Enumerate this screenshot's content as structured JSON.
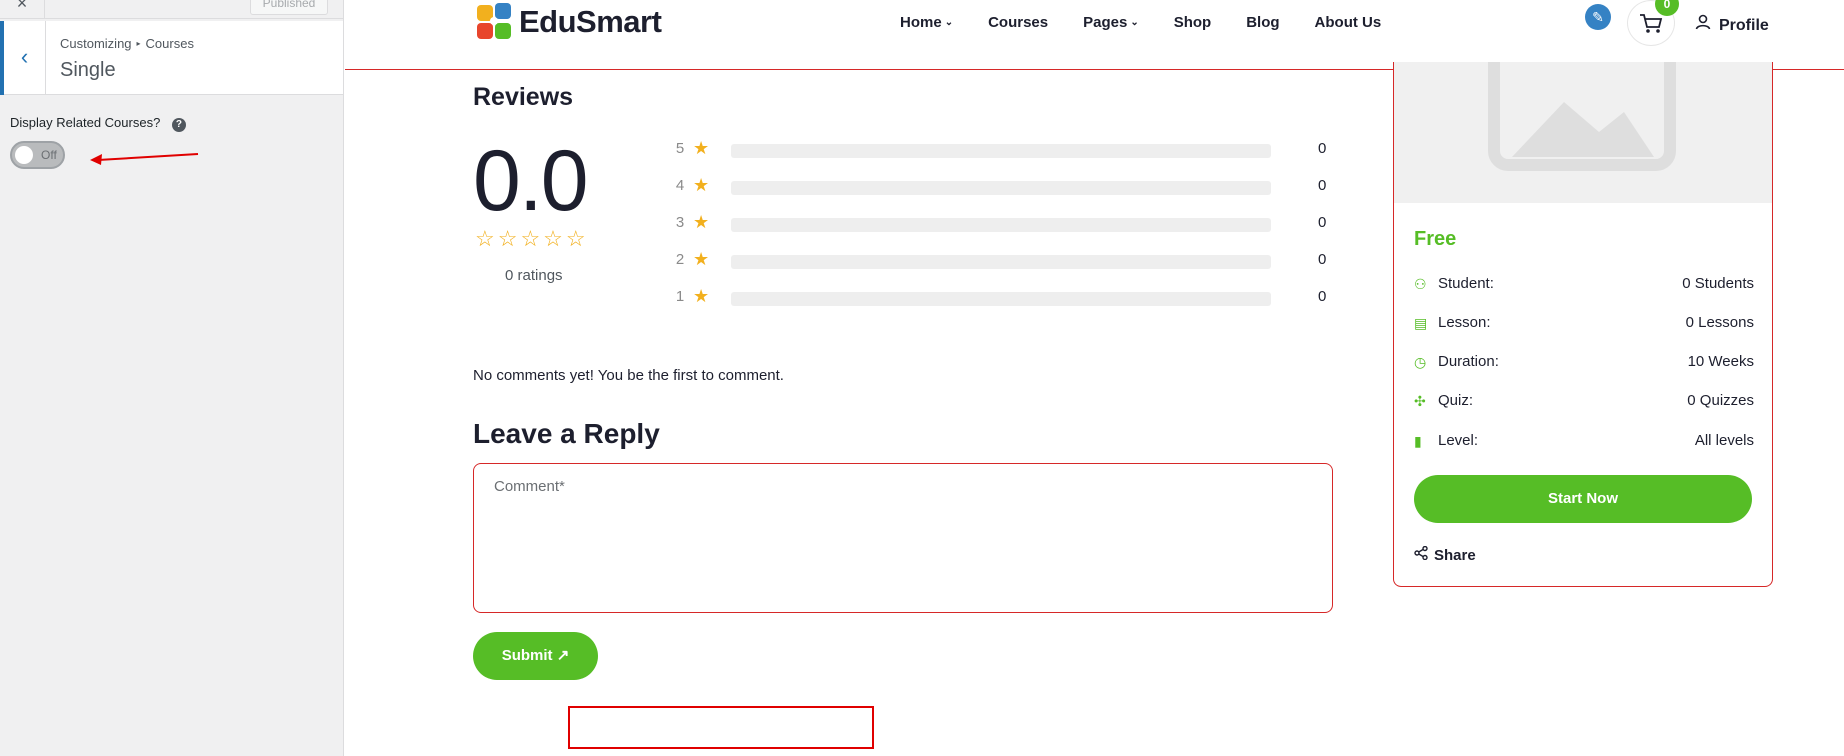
{
  "sidebar": {
    "close_glyph": "×",
    "published_label": "Published",
    "back_glyph": "‹",
    "breadcrumb": [
      "Customizing",
      "Courses"
    ],
    "breadcrumb_sep": "▸",
    "section_title": "Single",
    "option_label": "Display Related Courses?",
    "help_glyph": "?",
    "toggle": {
      "state_text": "Off",
      "on": false
    }
  },
  "header": {
    "logo_text": "EduSmart",
    "nav": [
      {
        "label": "Home",
        "has_dropdown": true
      },
      {
        "label": "Courses",
        "has_dropdown": false
      },
      {
        "label": "Pages",
        "has_dropdown": true
      },
      {
        "label": "Shop",
        "has_dropdown": false
      },
      {
        "label": "Blog",
        "has_dropdown": false
      },
      {
        "label": "About Us",
        "has_dropdown": false
      }
    ],
    "chevron_glyph": "⌄",
    "cart_count": "0",
    "profile_label": "Profile"
  },
  "reviews": {
    "title": "Reviews",
    "average": "0.0",
    "average_stars": "☆☆☆☆☆",
    "count_text": "0 ratings",
    "rows": [
      {
        "stars": "5",
        "count": "0",
        "fill": 0
      },
      {
        "stars": "4",
        "count": "0",
        "fill": 0
      },
      {
        "stars": "3",
        "count": "0",
        "fill": 0
      },
      {
        "stars": "2",
        "count": "0",
        "fill": 0
      },
      {
        "stars": "1",
        "count": "0",
        "fill": 0
      }
    ],
    "star_glyph": "★"
  },
  "comments": {
    "empty_text": "No comments yet! You be the first to comment.",
    "reply_title": "Leave a Reply",
    "comment_placeholder": "Comment*",
    "submit_label": "Submit ↗"
  },
  "course_card": {
    "price": "Free",
    "meta": [
      {
        "icon": "student-icon",
        "glyph": "⚇",
        "label": "Student:",
        "value": "0 Students"
      },
      {
        "icon": "lesson-icon",
        "glyph": "▤",
        "label": "Lesson:",
        "value": "0 Lessons"
      },
      {
        "icon": "clock-icon",
        "glyph": "◷",
        "label": "Duration:",
        "value": "10 Weeks"
      },
      {
        "icon": "puzzle-icon",
        "glyph": "✣",
        "label": "Quiz:",
        "value": "0 Quizzes"
      },
      {
        "icon": "level-icon",
        "glyph": "▮",
        "label": "Level:",
        "value": "All levels"
      }
    ],
    "start_label": "Start Now",
    "share_label": "Share",
    "share_glyph": "⋖"
  },
  "colors": {
    "accent_green": "#56bd26",
    "highlight_red": "#d62828",
    "star_yellow": "#f2b01e",
    "wp_blue": "#2271b1"
  }
}
